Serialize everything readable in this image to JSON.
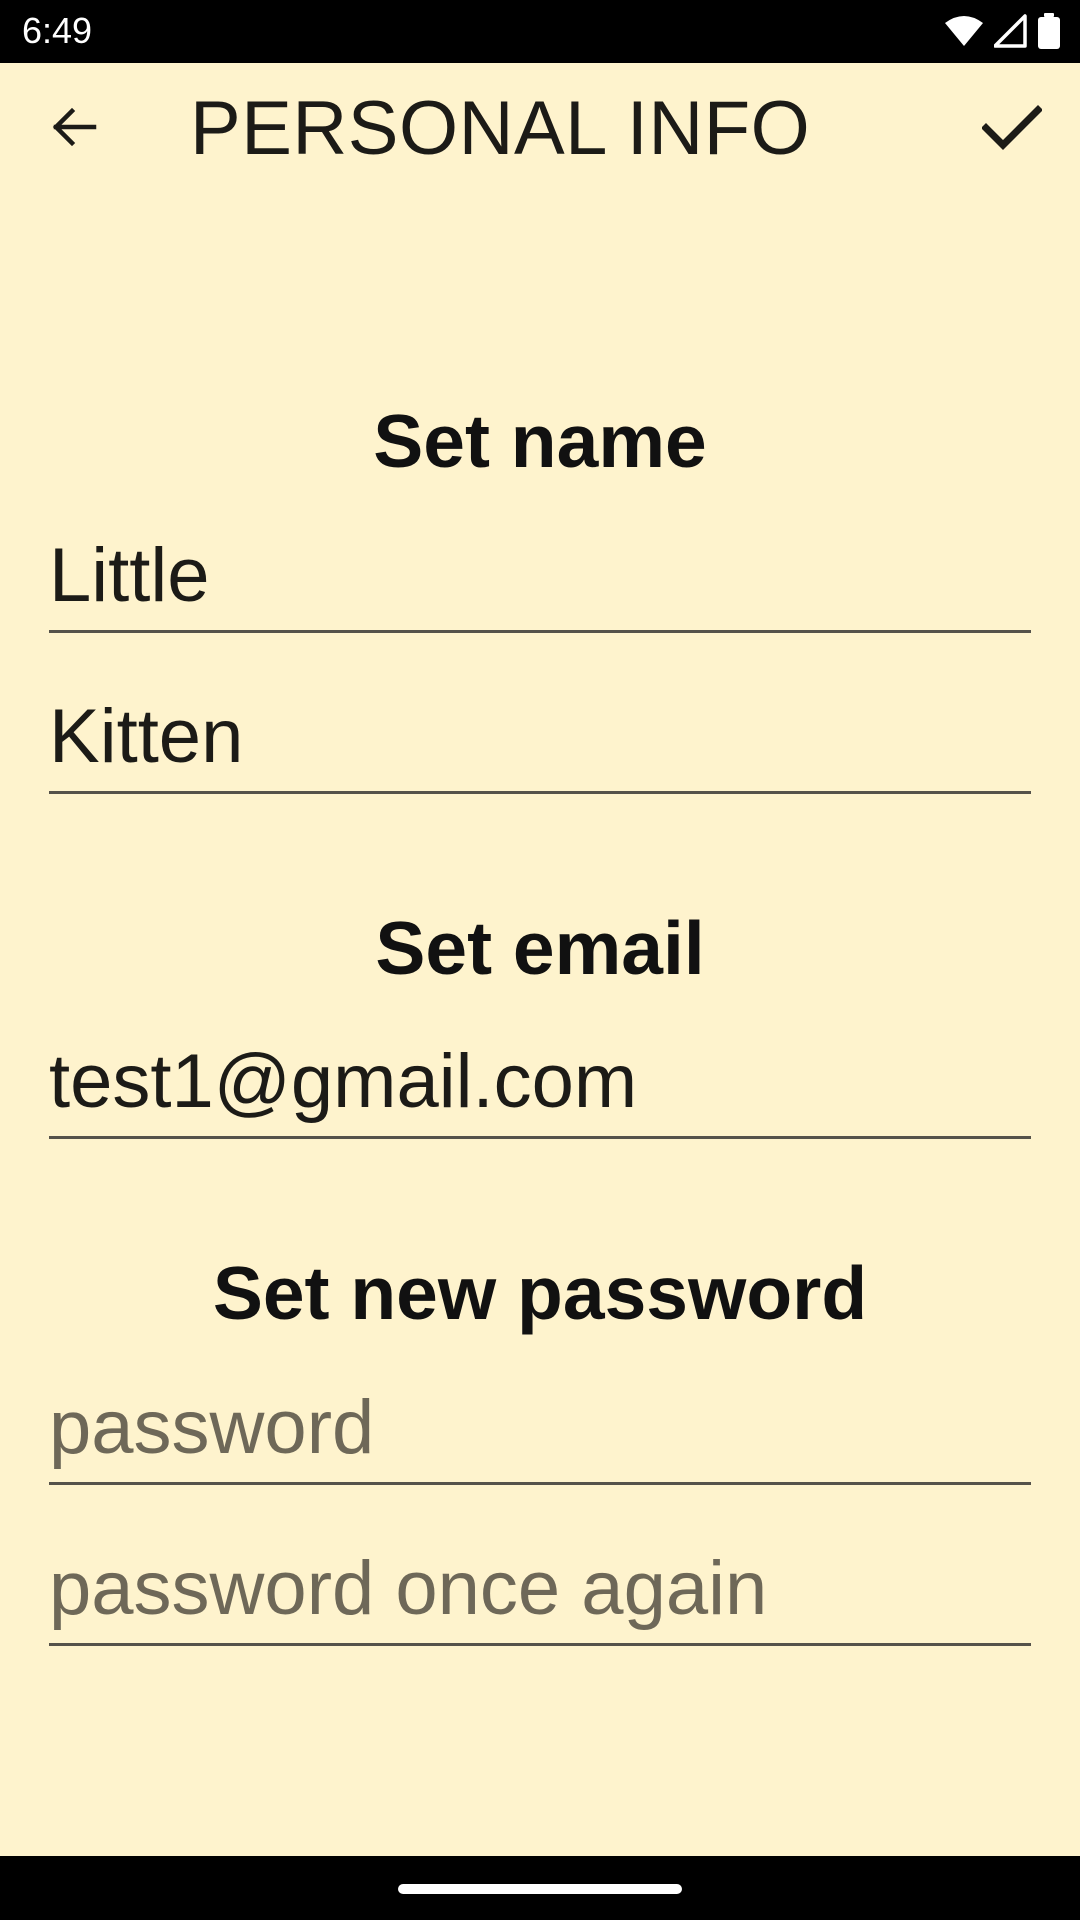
{
  "status_bar": {
    "time": "6:49",
    "icons": [
      "wifi-icon",
      "cell-signal-icon",
      "battery-icon"
    ]
  },
  "app_bar": {
    "title": "PERSONAL INFO",
    "back_icon": "arrow-back-icon",
    "confirm_icon": "check-icon"
  },
  "name_section": {
    "heading": "Set name",
    "first_name_value": "Little",
    "last_name_value": "Kitten"
  },
  "email_section": {
    "heading": "Set email",
    "email_value": "test1@gmail.com"
  },
  "password_section": {
    "heading": "Set new password",
    "password_placeholder": "password",
    "password_confirm_placeholder": "password once again"
  },
  "colors": {
    "background": "#fef3cd",
    "text": "#1c1b17",
    "underline": "#55524a",
    "placeholder": "#6e6858",
    "system_bars": "#000000"
  }
}
